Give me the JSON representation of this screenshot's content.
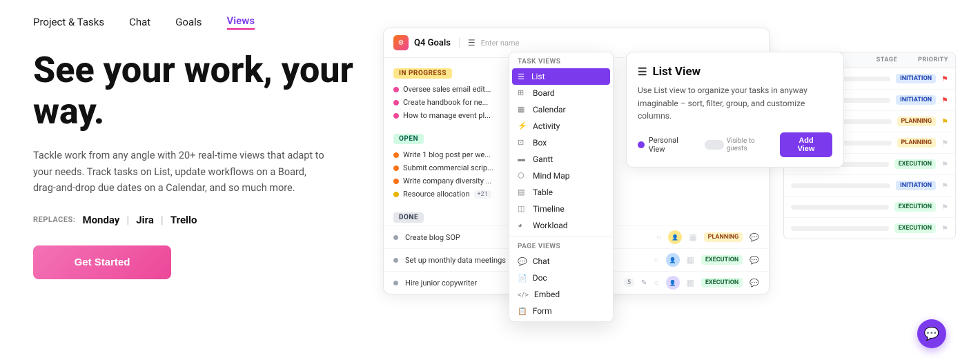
{
  "nav": {
    "items": [
      {
        "label": "Project & Tasks",
        "active": false
      },
      {
        "label": "Chat",
        "active": false
      },
      {
        "label": "Goals",
        "active": false
      },
      {
        "label": "Views",
        "active": true
      }
    ]
  },
  "hero": {
    "headline": "See your work, your way.",
    "subtext": "Tackle work from any angle with 20+ real-time views that adapt to your needs. Track tasks on List, update workflows on a Board, drag-and-drop due dates on a Calendar, and so much more.",
    "replaces_label": "REPLACES:",
    "brands": [
      "Monday",
      "Jira",
      "Trello"
    ],
    "cta": "Get Started"
  },
  "mockup": {
    "q4_title": "Q4 Goals",
    "enter_name": "Enter name",
    "task_views_label": "TASK VIEWS",
    "page_views_label": "PAGE VIEWS",
    "task_views": [
      {
        "label": "List",
        "selected": true,
        "icon": "☰"
      },
      {
        "label": "Board",
        "selected": false,
        "icon": "⊞"
      },
      {
        "label": "Calendar",
        "selected": false,
        "icon": "▦"
      },
      {
        "label": "Activity",
        "selected": false,
        "icon": "⚡"
      },
      {
        "label": "Box",
        "selected": false,
        "icon": "⊡"
      },
      {
        "label": "Gantt",
        "selected": false,
        "icon": "▬"
      },
      {
        "label": "Mind Map",
        "selected": false,
        "icon": "⬡"
      },
      {
        "label": "Table",
        "selected": false,
        "icon": "▤"
      },
      {
        "label": "Timeline",
        "selected": false,
        "icon": "◫"
      },
      {
        "label": "Workload",
        "selected": false,
        "icon": "◕"
      }
    ],
    "page_views": [
      {
        "label": "Chat",
        "icon": "💬"
      },
      {
        "label": "Doc",
        "icon": "📄"
      },
      {
        "label": "Embed",
        "icon": "</>"
      },
      {
        "label": "Form",
        "icon": "📋"
      }
    ],
    "sections": [
      {
        "badge": "IN PROGRESS",
        "badge_type": "inprogress",
        "tasks": [
          {
            "name": "Oversee sales email edit...",
            "dot": "pink"
          },
          {
            "name": "Create handbook for ne...",
            "dot": "pink"
          },
          {
            "name": "How to manage event pl...",
            "dot": "pink"
          }
        ]
      },
      {
        "badge": "OPEN",
        "badge_type": "open",
        "tasks": [
          {
            "name": "Write 1 blog post per we...",
            "dot": "orange"
          },
          {
            "name": "Submit commercial scrip...",
            "dot": "orange"
          },
          {
            "name": "Write company diversity ...",
            "dot": "orange"
          },
          {
            "name": "Resource allocation",
            "dot": "yellow",
            "count": "+21"
          }
        ]
      },
      {
        "badge": "DONE",
        "badge_type": "done",
        "tasks": [
          {
            "name": "Create blog SOP",
            "dot": "gray"
          },
          {
            "name": "Set up monthly data meetings",
            "dot": "gray"
          },
          {
            "name": "Hire junior copywriter",
            "dot": "gray",
            "count": "5"
          }
        ]
      }
    ],
    "list_view": {
      "title": "List View",
      "description": "Use List view to organize your tasks in anyway imaginable – sort, filter, group, and customize columns.",
      "personal_view": "Personal View",
      "visible_to_guests": "Visible to guests",
      "add_view": "Add View"
    },
    "bg_table": {
      "columns": [
        "STAGE",
        "PRIORITY"
      ],
      "rows": [
        {
          "stage": "INITIATION",
          "stage_type": "initiation",
          "priority": "red"
        },
        {
          "stage": "INITIATION",
          "stage_type": "initiation",
          "priority": "red"
        },
        {
          "stage": "PLANNING",
          "stage_type": "planning",
          "priority": "yellow"
        }
      ]
    },
    "bottom_rows": [
      {
        "name": "Create blog SOP",
        "avatar": "1",
        "stage": "PLANNING",
        "stage_type": "planning"
      },
      {
        "name": "Set up monthly data meetings",
        "avatar": "2",
        "stage": "EXECUTION",
        "stage_type": "execution"
      },
      {
        "name": "Hire junior copywriter",
        "avatar": "3",
        "count": "5",
        "stage": "EXECUTION",
        "stage_type": "execution"
      }
    ]
  },
  "chat_bubble": "💬"
}
